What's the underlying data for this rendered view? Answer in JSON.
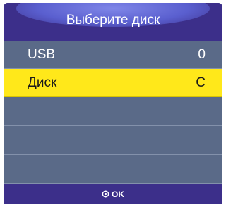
{
  "dialog": {
    "title": "Выберите диск"
  },
  "drives": [
    {
      "name": "USB",
      "letter": "0",
      "selected": false
    },
    {
      "name": "Диск",
      "letter": "C",
      "selected": true
    }
  ],
  "footer": {
    "ok_label": "OK",
    "ok_icon": "ok-button-icon"
  },
  "colors": {
    "header": "#3c2f8a",
    "list_bg": "#5a6a88",
    "selected_bg": "#ffe81a",
    "text": "#ffffff",
    "selected_text": "#1b1b1b"
  }
}
